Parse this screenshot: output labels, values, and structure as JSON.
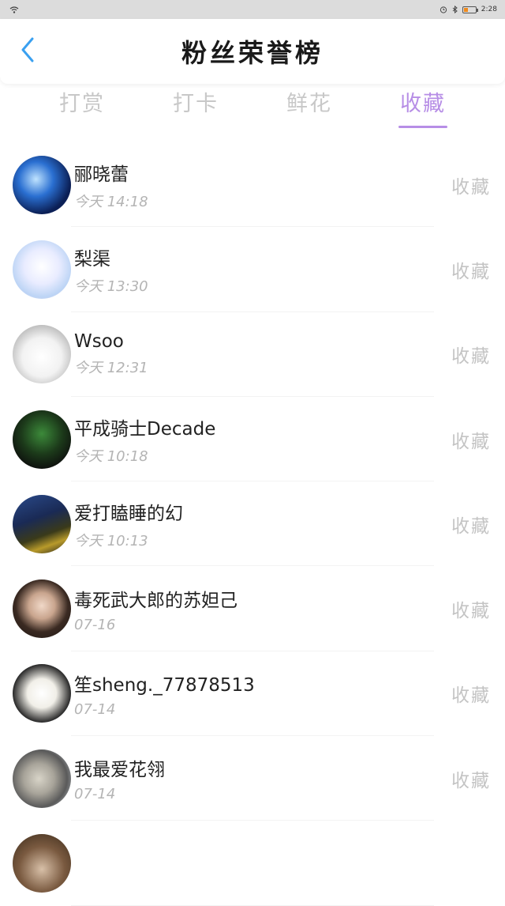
{
  "status_bar": {
    "time": "2:28"
  },
  "header": {
    "title": "粉丝荣誉榜"
  },
  "tabs": [
    {
      "label": "打赏"
    },
    {
      "label": "打卡"
    },
    {
      "label": "鲜花"
    },
    {
      "label": "收藏"
    }
  ],
  "active_tab": "收藏",
  "colors": {
    "accent": "#b78ee6",
    "inactive_tab": "#c8c8c8",
    "back_arrow": "#3aa0f0"
  },
  "items": [
    {
      "name": "郦晓蕾",
      "time": "今天 14:18",
      "action": "收藏"
    },
    {
      "name": "梨渠",
      "time": "今天 13:30",
      "action": "收藏"
    },
    {
      "name": "Wsoo",
      "time": "今天 12:31",
      "action": "收藏"
    },
    {
      "name": "平成骑士Decade",
      "time": "今天 10:18",
      "action": "收藏"
    },
    {
      "name": "爱打瞌睡的幻",
      "time": "今天 10:13",
      "action": "收藏"
    },
    {
      "name": "毒死武大郎的苏妲己",
      "time": "07-16",
      "action": "收藏"
    },
    {
      "name": "笙sheng._77878513",
      "time": "07-14",
      "action": "收藏"
    },
    {
      "name": "我最爱花翎",
      "time": "07-14",
      "action": "收藏"
    },
    {
      "name": "",
      "time": "",
      "action": ""
    }
  ]
}
